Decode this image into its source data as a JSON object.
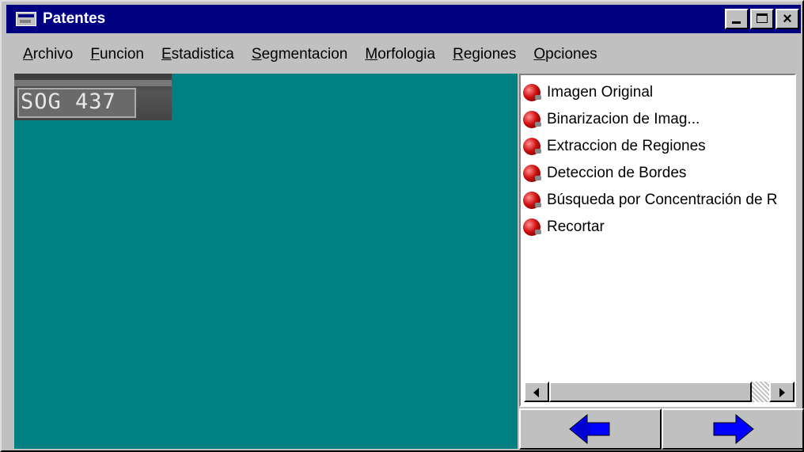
{
  "window": {
    "title": "Patentes",
    "title_icon": "window-app-icon",
    "controls": [
      "minimize",
      "maximize",
      "close"
    ]
  },
  "menubar": {
    "items": [
      {
        "accel": "A",
        "rest": "rchivo"
      },
      {
        "accel": "F",
        "rest": "uncion"
      },
      {
        "accel": "E",
        "rest": "stadistica"
      },
      {
        "accel": "S",
        "rest": "egmentacion"
      },
      {
        "accel": "M",
        "rest": "orfologia"
      },
      {
        "accel": "R",
        "rest": "egiones"
      },
      {
        "accel": "O",
        "rest": "pciones"
      }
    ]
  },
  "image_view": {
    "plate_text": "SOG 437",
    "background": "#008080"
  },
  "operations_list": {
    "item_icon": "red-ball-icon",
    "items": [
      "Imagen Original",
      "Binarizacion de Imag...",
      "Extraccion de Regiones",
      "Deteccion de Bordes",
      "Búsqueda por Concentración de R",
      "Recortar"
    ]
  },
  "navigation": {
    "back_icon": "arrow-left-icon",
    "forward_icon": "arrow-right-icon",
    "arrow_color": "#0000ff"
  }
}
